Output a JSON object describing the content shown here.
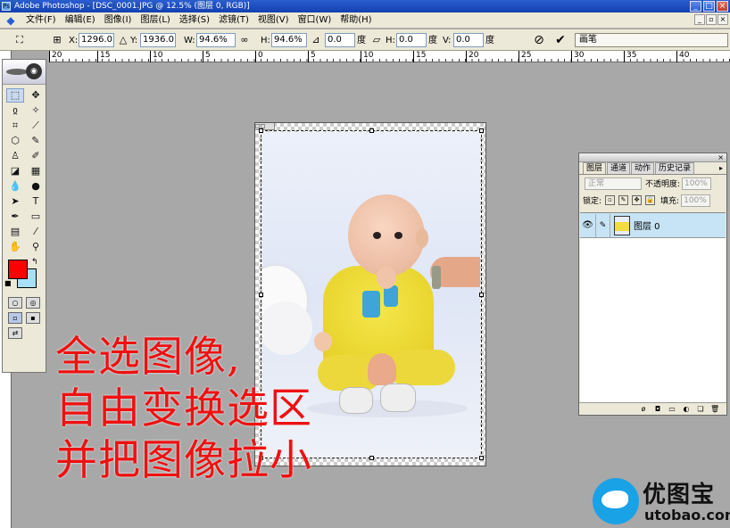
{
  "window": {
    "title": "Adobe Photoshop - [DSC_0001.JPG @ 12.5% (图层 0, RGB)]",
    "controls": [
      "_",
      "□",
      "×"
    ]
  },
  "menubar": {
    "items": [
      "文件(F)",
      "编辑(E)",
      "图像(I)",
      "图层(L)",
      "选择(S)",
      "滤镜(T)",
      "视图(V)",
      "窗口(W)",
      "帮助(H)"
    ],
    "doc_controls": [
      "_",
      "▫",
      "×"
    ]
  },
  "options": {
    "x_label": "X:",
    "x_value": "1296.0",
    "y_label": "Y:",
    "y_value": "1936.0",
    "w_label": "W:",
    "w_value": "94.6%",
    "h_label": "H:",
    "h_value": "94.6%",
    "rot_value": "0.0",
    "deg1": "度",
    "hskew_label": "H:",
    "hskew_value": "0.0",
    "deg2": "度",
    "vskew_label": "V:",
    "vskew_value": "0.0",
    "deg3": "度",
    "brush_tab": "画笔"
  },
  "ruler": {
    "labels": [
      "20",
      "15",
      "10",
      "5",
      "0",
      "5",
      "10",
      "15",
      "20",
      "25",
      "30",
      "35",
      "40"
    ]
  },
  "overlay": {
    "line1": "全选图像,",
    "line2": "自由变换选区",
    "line3": "并把图像拉小"
  },
  "layers_panel": {
    "tabs": [
      "图层",
      "通道",
      "动作",
      "历史记录"
    ],
    "blend_mode": "正常",
    "opacity_label": "不透明度:",
    "opacity_value": "100%",
    "lock_label": "锁定:",
    "fill_label": "填充:",
    "fill_value": "100%",
    "layer_name": "图层 0"
  },
  "watermark": {
    "title": "优图宝",
    "url": "utobao.com"
  },
  "colors": {
    "foreground": "#ff0000",
    "background": "#a8e0f8",
    "overlay_text": "#ee1111"
  }
}
